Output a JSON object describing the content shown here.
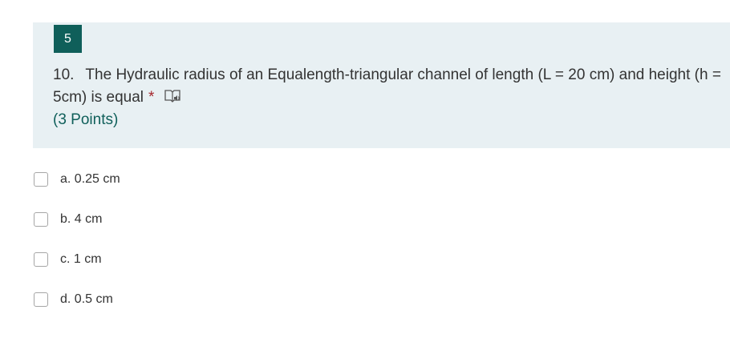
{
  "section": {
    "number": "5"
  },
  "question": {
    "number": "10.",
    "text_line": "The Hydraulic radius of an Equalength-triangular channel of length (L = 20 cm) and height (h = 5cm) is equal",
    "required_marker": "*",
    "points": "(3 Points)",
    "icon": "immersive-reader-icon"
  },
  "options": [
    {
      "label": "a. 0.25 cm",
      "checked": false
    },
    {
      "label": "b. 4 cm",
      "checked": false
    },
    {
      "label": "c. 1 cm",
      "checked": false
    },
    {
      "label": "d. 0.5 cm",
      "checked": false
    }
  ],
  "colors": {
    "accent": "#0f5f5a",
    "card_background": "#e8f0f3",
    "required": "#a4262c"
  }
}
